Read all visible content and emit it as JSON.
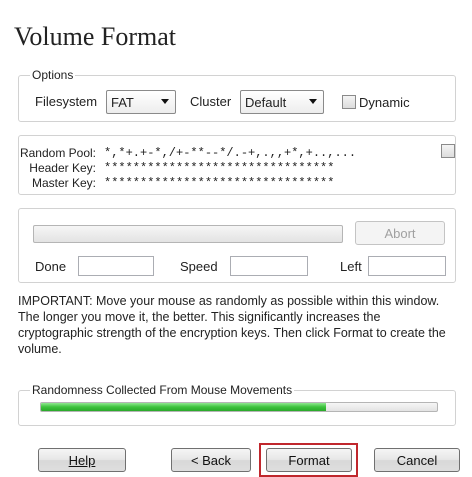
{
  "title": "Volume Format",
  "options": {
    "group_label": "Options",
    "filesystem_label": "Filesystem",
    "filesystem_value": "FAT",
    "cluster_label": "Cluster",
    "cluster_value": "Default",
    "dynamic_label": "Dynamic",
    "dynamic_checked": false
  },
  "keys": {
    "random_pool_label": "Random Pool:",
    "random_pool_value": "*,*+.+-*,/+-**--*/.-+,.,,+*,+..,...",
    "header_key_label": "Header Key:",
    "header_key_value": "********************************",
    "master_key_label": "Master Key:",
    "master_key_value": "********************************",
    "show_checked": false
  },
  "progress": {
    "abort_label": "Abort",
    "done_label": "Done",
    "speed_label": "Speed",
    "left_label": "Left",
    "done_value": "",
    "speed_value": "",
    "left_value": "",
    "format_progress_fraction": 0
  },
  "info_text": "IMPORTANT: Move your mouse as randomly as possible within this window. The longer you move it, the better. This significantly increases the cryptographic strength of the encryption keys. Then click Format to create the volume.",
  "randomness": {
    "label": "Randomness Collected From Mouse Movements",
    "fraction": 0.72,
    "color": "#3cc23c"
  },
  "buttons": {
    "help_label": "Help",
    "back_label": "< Back",
    "format_label": "Format",
    "cancel_label": "Cancel"
  },
  "colors": {
    "highlight": "#c0272d"
  }
}
